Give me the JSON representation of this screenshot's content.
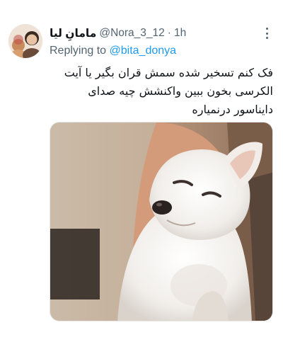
{
  "tweet": {
    "author": {
      "display_name": "مامانِ لیا",
      "handle": "@Nora_3_12",
      "separator": "·",
      "time": "1h",
      "avatar_icon": "profile-photo"
    },
    "reply": {
      "prefix": "Replying to ",
      "handle": "@bita_donya"
    },
    "text": "فک کنم تسخیر شده سمش قران بگیر یا آیت الکرسی بخون ببین واکنشش چیه صدای دایناسور درنمیاره",
    "media": {
      "kind": "photo",
      "subject": "white-chihuahua-photo"
    },
    "more_icon": "more-vertical-icon"
  },
  "colors": {
    "text": "#0f1419",
    "secondary": "#536471",
    "link": "#1d9bf0",
    "background": "#ffffff"
  }
}
